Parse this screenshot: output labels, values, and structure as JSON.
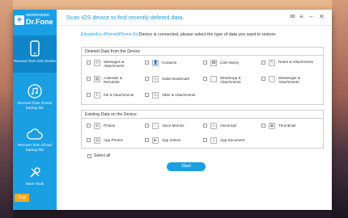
{
  "app": {
    "brand_small": "wondershare",
    "brand_name": "Dr.Fone",
    "title": "Scan iOS device to find recently deleted data.",
    "trial_label": "Trial"
  },
  "sidebar": {
    "items": [
      {
        "label": "Recover from iOS Device",
        "icon": "phone-icon",
        "active": true
      },
      {
        "label": "Recover from iTunes backup file",
        "icon": "music-icon",
        "active": false
      },
      {
        "label": "Recover from iCloud backup file",
        "icon": "cloud-icon",
        "active": false
      },
      {
        "label": "More Tools",
        "icon": "tools-icon",
        "active": false
      }
    ]
  },
  "status": {
    "device": "Elizabeth's iPhone(iPhone 6s)",
    "message": "Device is connected, please select the type of data you want to restore."
  },
  "deleted_section": {
    "title": "Deleted Data from the Device",
    "options": [
      {
        "label": "Messages & Attachments",
        "icon": "messages-icon"
      },
      {
        "label": "Contacts",
        "icon": "contacts-icon"
      },
      {
        "label": "Call History",
        "icon": "call-history-icon"
      },
      {
        "label": "Notes & Attachments",
        "icon": "notes-icon"
      },
      {
        "label": "Calendar & Reminder",
        "icon": "calendar-icon"
      },
      {
        "label": "Safari Bookmark",
        "icon": "safari-icon"
      },
      {
        "label": "WhatsApp & Attachments",
        "icon": "whatsapp-icon"
      },
      {
        "label": "Messenger & Attachments",
        "icon": "messenger-icon"
      },
      {
        "label": "Kik & Attachments",
        "icon": "kik-icon"
      },
      {
        "label": "Viber & Attachments",
        "icon": "viber-icon"
      }
    ]
  },
  "existing_section": {
    "title": "Existing Data on the Device",
    "options": [
      {
        "label": "Photos",
        "icon": "photos-icon"
      },
      {
        "label": "Voice Memos",
        "icon": "voice-memos-icon"
      },
      {
        "label": "Voicemail",
        "icon": "voicemail-icon"
      },
      {
        "label": "Thumbnail",
        "icon": "thumbnail-icon"
      },
      {
        "label": "App Photos",
        "icon": "app-photos-icon"
      },
      {
        "label": "App Videos",
        "icon": "app-videos-icon"
      },
      {
        "label": "App Document",
        "icon": "app-document-icon"
      }
    ]
  },
  "select_all_label": "Select all",
  "start_label": "Start",
  "colors": {
    "accent": "#1a9fe3",
    "trial": "#f7a823"
  }
}
